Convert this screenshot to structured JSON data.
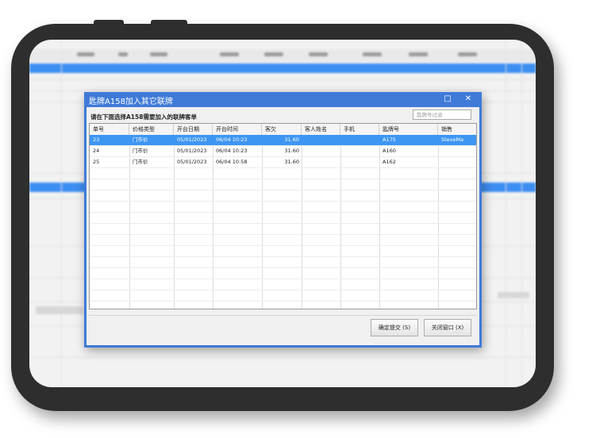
{
  "dialog": {
    "title": "匙牌A158加入其它联牌",
    "maximize_glyph": "□",
    "close_glyph": "✕",
    "instruction": "请在下面选择A158需要加入的联牌客单",
    "filter_placeholder": "匙牌号过滤",
    "filter_value": ""
  },
  "table": {
    "columns": [
      "单号",
      "价格类型",
      "开台日期",
      "开台时间",
      "客欠",
      "客人姓名",
      "手机",
      "匙牌号",
      "销售"
    ],
    "rows": [
      {
        "cells": [
          "23",
          "门市价",
          "05/01/2023",
          "06/04 10:23",
          "31.60",
          "",
          "",
          "A175",
          "SteveMa"
        ],
        "selected": true
      },
      {
        "cells": [
          "24",
          "门市价",
          "05/01/2023",
          "06/04 10:23",
          "31.60",
          "",
          "",
          "A160",
          ""
        ],
        "selected": false
      },
      {
        "cells": [
          "25",
          "门市价",
          "05/01/2023",
          "06/04 10:58",
          "31.60",
          "",
          "",
          "A162",
          ""
        ],
        "selected": false
      }
    ]
  },
  "buttons": {
    "submit": "确定提交 (S)",
    "close": "关闭窗口 (X)"
  },
  "colors": {
    "dialog_frame": "#3f7ad8",
    "selected_row": "#3d96f2",
    "device_frame": "#2e2e2e"
  }
}
